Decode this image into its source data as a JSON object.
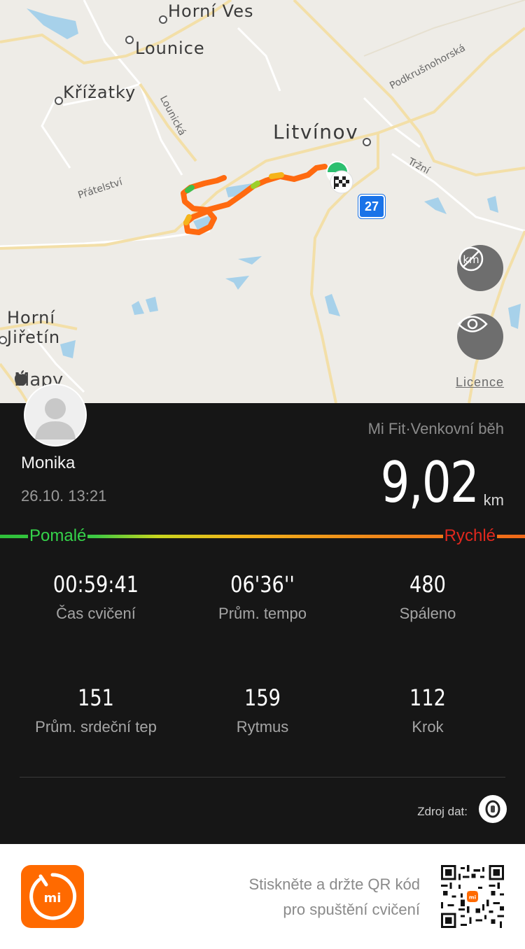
{
  "map": {
    "places": {
      "horni_ves": "Horní Ves",
      "lounice": "Lounice",
      "krizatky": "Křížatky",
      "litvinov": "Litvínov",
      "horni_jiretin_1": "Horní",
      "horni_jiretin_2": "Jiřetín"
    },
    "roads": {
      "lounicka": "Lounická",
      "pratelstvi": "Přátelství",
      "podkrusnohorska": "Podkrušnohorská",
      "trzni": "Tržní"
    },
    "route_badge": "27",
    "maps_brand": "Mapy",
    "licence": "Licence",
    "buttons": {
      "units_icon": "km-off-icon",
      "view_icon": "eye-icon"
    }
  },
  "workout": {
    "user_name": "Monika",
    "datetime": "26.10. 13:21",
    "source": "Mi Fit·Venkovní běh",
    "distance": "9,02",
    "distance_unit": "km",
    "pace_slow": "Pomalé",
    "pace_fast": "Rychlé",
    "stats": [
      {
        "value": "00:59:41",
        "label": "Čas cvičení"
      },
      {
        "value": "06'36''",
        "label": "Prům. tempo"
      },
      {
        "value": "480",
        "label": "Spáleno"
      },
      {
        "value": "151",
        "label": "Prům. srdeční tep"
      },
      {
        "value": "159",
        "label": "Rytmus"
      },
      {
        "value": "112",
        "label": "Krok"
      }
    ],
    "data_source_label": "Zdroj dat:"
  },
  "footer": {
    "qr_line1": "Stiskněte a držte QR kód",
    "qr_line2": "pro spuštění cvičení"
  },
  "colors": {
    "route": "#ff6a10",
    "panel": "#161616",
    "accent": "#ff6a00",
    "slow": "#35d24a",
    "fast": "#e0281e"
  }
}
